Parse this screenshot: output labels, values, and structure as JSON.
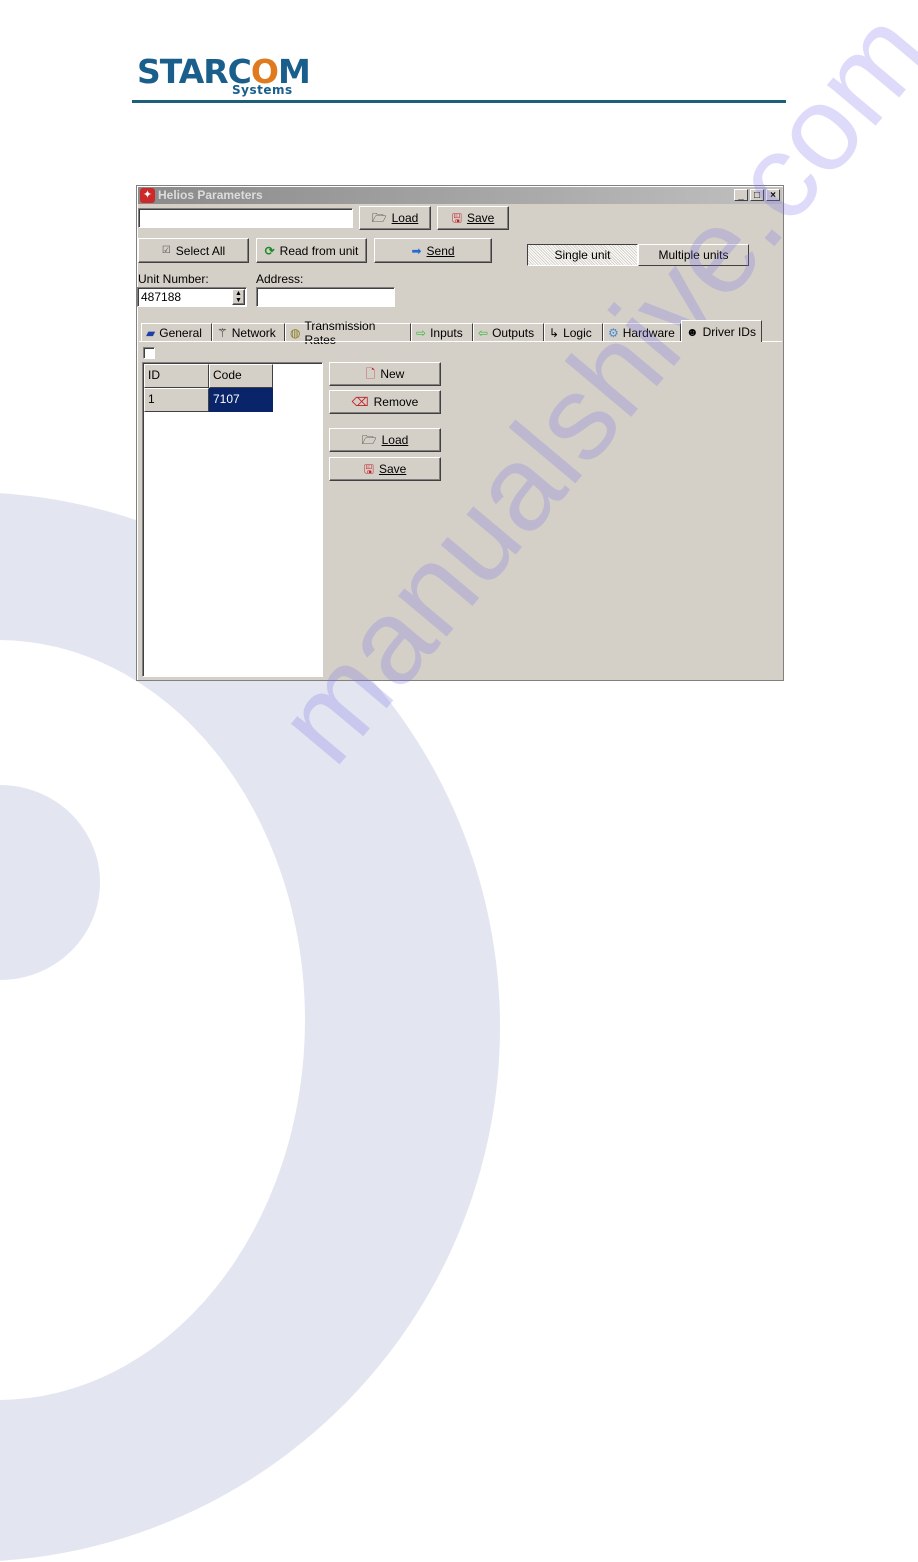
{
  "header": {
    "logo_main_prefix": "STARC",
    "logo_main_o": "O",
    "logo_main_suffix": "M",
    "logo_sub": "Systems",
    "brand_color": "#1a5f8c",
    "accent_color": "#e07a1f"
  },
  "window": {
    "title": "Helios Parameters",
    "controls": {
      "minimize": "_",
      "maximize": "□",
      "close": "×"
    }
  },
  "toolbar": {
    "file_path_value": "",
    "load_label": "Load",
    "load_icon": "folder-document-icon",
    "save_label": "Save",
    "save_icon": "save-disk-icon",
    "select_all_label": "Select All",
    "read_from_unit_label": "Read from unit",
    "send_label": "Send",
    "mode": {
      "options": [
        "Single unit",
        "Multiple units"
      ],
      "selected": "Single unit"
    }
  },
  "unit": {
    "unit_number_label": "Unit Number:",
    "unit_number_value": "487188",
    "address_label": "Address:",
    "address_value": ""
  },
  "tabs": [
    {
      "label": "General",
      "icon": "general-icon",
      "active": false
    },
    {
      "label": "Network",
      "icon": "antenna-icon",
      "active": false
    },
    {
      "label": "Transmission Rates",
      "icon": "satellite-dish-icon",
      "active": false
    },
    {
      "label": "Inputs",
      "icon": "arrow-right-icon",
      "active": false
    },
    {
      "label": "Outputs",
      "icon": "arrow-left-icon",
      "active": false
    },
    {
      "label": "Logic",
      "icon": "logic-icon",
      "active": false
    },
    {
      "label": "Hardware",
      "icon": "gear-icon",
      "active": false
    },
    {
      "label": "Driver IDs",
      "icon": "drivers-icon",
      "active": true
    }
  ],
  "driver_ids": {
    "enabled_checked": false,
    "columns": [
      "ID",
      "Code"
    ],
    "rows": [
      {
        "id": "1",
        "code": "7107",
        "selected": true
      }
    ],
    "buttons": {
      "new_label": "New",
      "remove_label": "Remove",
      "load_label": "Load",
      "save_label": "Save"
    }
  },
  "watermark": "manualshive.com"
}
